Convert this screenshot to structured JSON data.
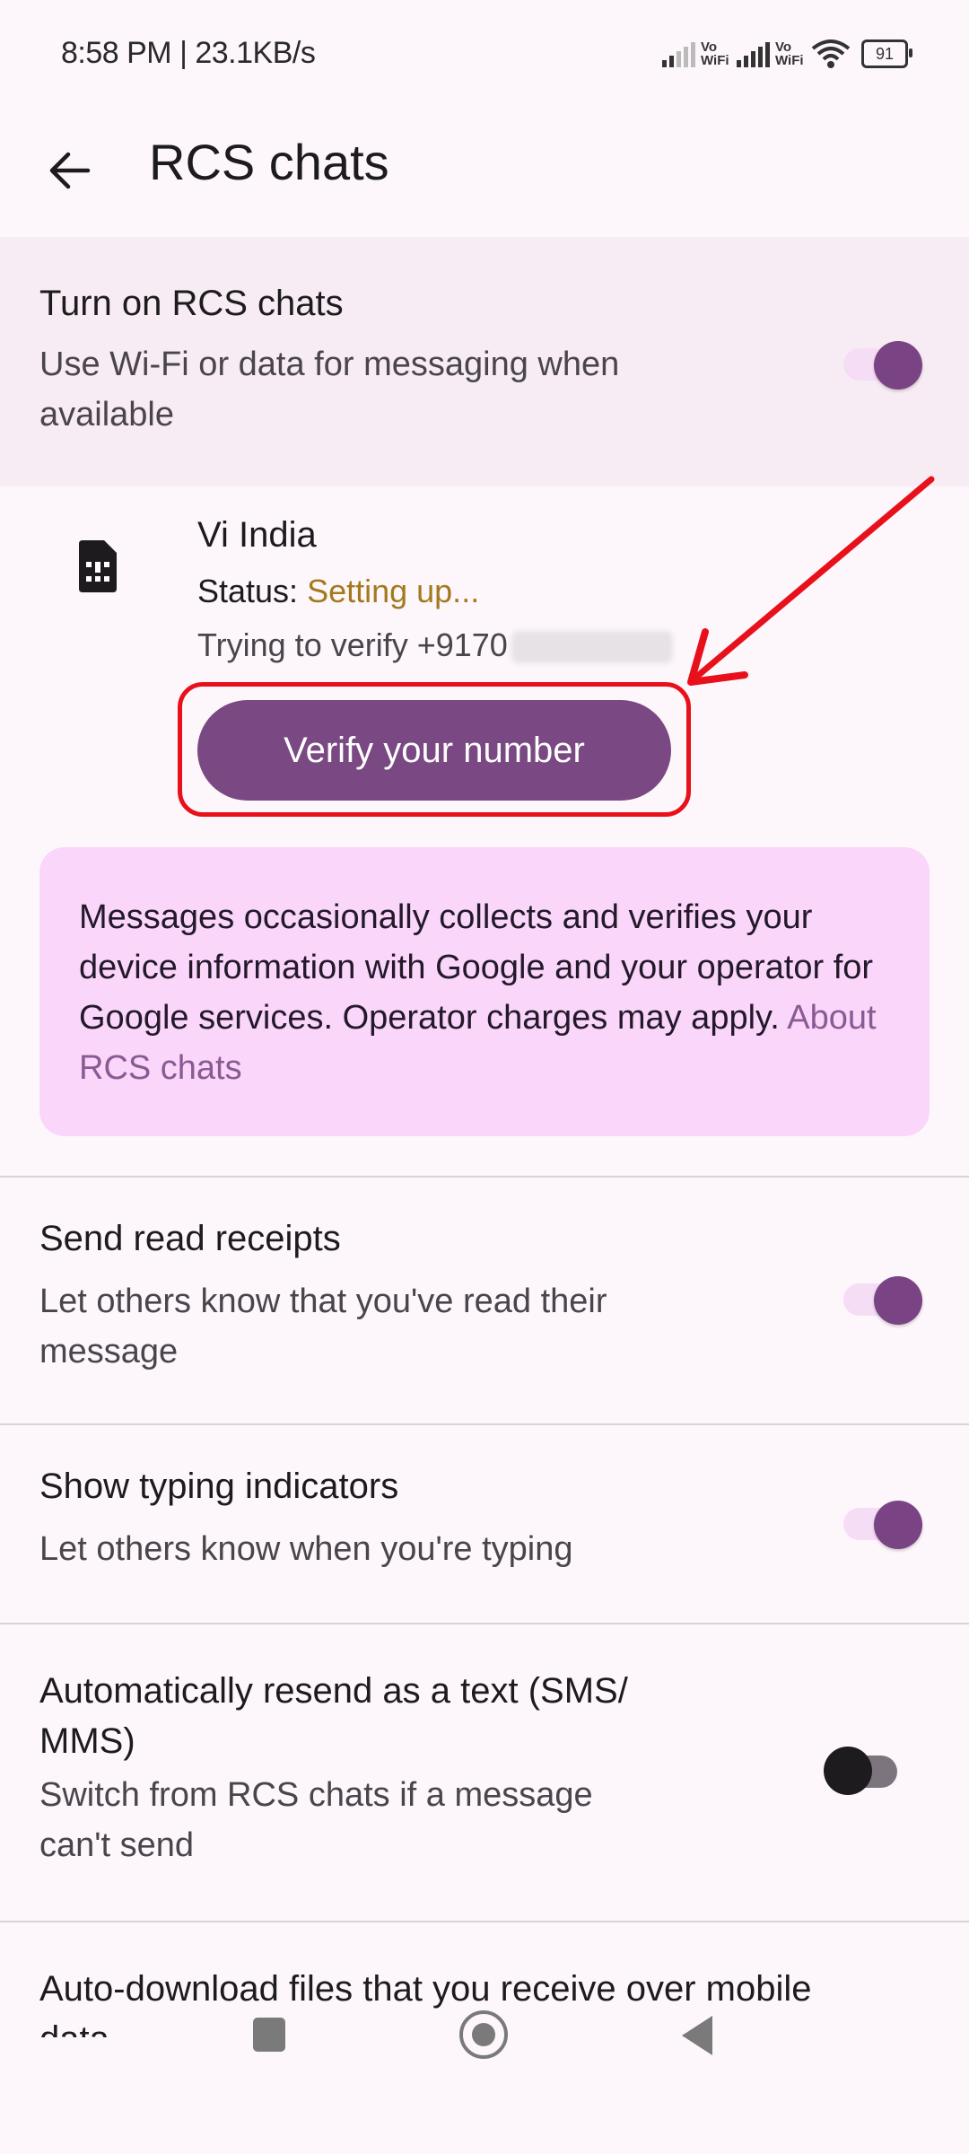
{
  "status_bar": {
    "time_speed": "8:58 PM | 23.1KB/s",
    "vowifi_1": "Vo\nWiFi",
    "vowifi_2": "Vo\nWiFi",
    "battery": "91"
  },
  "app_bar": {
    "back_icon": "arrow-left",
    "title": "RCS chats"
  },
  "rcs_master": {
    "title": "Turn on RCS chats",
    "subtitle_line1": "Use Wi-Fi or data for messaging when",
    "subtitle_line2": "available",
    "enabled": true
  },
  "sim": {
    "icon": "sim-card",
    "carrier": "Vi India",
    "status_label": "Status: ",
    "status_value": "Setting up...",
    "status_color": "#a4791e",
    "verify_text": "Trying to verify +9170",
    "verify_button": "Verify your number"
  },
  "info_card": {
    "text": "Messages occasionally collects and verifies your device information with Google and your operator for Google services. Operator charges may apply. ",
    "link": "About RCS chats"
  },
  "settings": [
    {
      "title": "Send read receipts",
      "subtitle_line1": "Let others know that you've read their",
      "subtitle_line2": "message",
      "enabled": true
    },
    {
      "title": "Show typing indicators",
      "subtitle_line1": "Let others know when you're typing",
      "subtitle_line2": "",
      "enabled": true
    },
    {
      "title_line1": "Automatically resend as a text (SMS/",
      "title_line2": "MMS)",
      "subtitle_line1": "Switch from RCS chats if a message",
      "subtitle_line2": "can't send",
      "enabled": false
    },
    {
      "title_line1": "Auto-download files that you receive over mobile",
      "title_line2": "data"
    }
  ],
  "nav_bar": {
    "recents_icon": "square",
    "home_icon": "circle",
    "back_icon": "triangle"
  },
  "colors": {
    "accent": "#7a4882",
    "annotation_red": "#e8111b",
    "info_card_bg": "#fad6fa"
  }
}
